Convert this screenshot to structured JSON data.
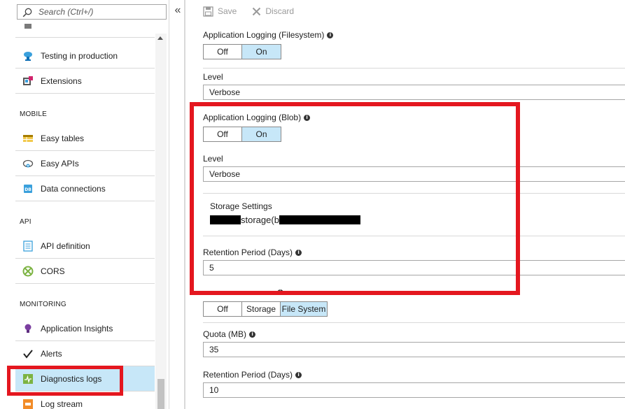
{
  "search": {
    "placeholder": "Search (Ctrl+/)"
  },
  "sidebar": {
    "collapse_glyph": "«",
    "items_top": [
      {
        "label": "Testing in production",
        "icon": "cloud-flask-icon"
      },
      {
        "label": "Extensions",
        "icon": "extensions-icon"
      }
    ],
    "sections": [
      {
        "header": "MOBILE",
        "items": [
          {
            "label": "Easy tables",
            "icon": "table-icon"
          },
          {
            "label": "Easy APIs",
            "icon": "cloud-api-icon"
          },
          {
            "label": "Data connections",
            "icon": "database-icon"
          }
        ]
      },
      {
        "header": "API",
        "items": [
          {
            "label": "API definition",
            "icon": "document-icon"
          },
          {
            "label": "CORS",
            "icon": "cors-icon"
          }
        ]
      },
      {
        "header": "MONITORING",
        "items": [
          {
            "label": "Application Insights",
            "icon": "lightbulb-icon"
          },
          {
            "label": "Alerts",
            "icon": "checkmark-icon"
          },
          {
            "label": "Diagnostics logs",
            "icon": "diagnostics-icon",
            "selected": true
          },
          {
            "label": "Log stream",
            "icon": "log-stream-icon"
          }
        ]
      }
    ]
  },
  "toolbar": {
    "save_label": "Save",
    "discard_label": "Discard"
  },
  "form": {
    "app_logging_fs": {
      "label": "Application Logging (Filesystem)",
      "off": "Off",
      "on": "On",
      "value": "On"
    },
    "level_fs": {
      "label": "Level",
      "value": "Verbose"
    },
    "app_logging_blob": {
      "label": "Application Logging (Blob)",
      "off": "Off",
      "on": "On",
      "value": "On"
    },
    "level_blob": {
      "label": "Level",
      "value": "Verbose"
    },
    "storage": {
      "label": "Storage Settings",
      "value": "storage(b"
    },
    "retention_blob": {
      "label": "Retention Period (Days)",
      "value": "5"
    },
    "web_logging": {
      "options": [
        "Off",
        "Storage",
        "File System"
      ],
      "value": "File System"
    },
    "quota": {
      "label": "Quota (MB)",
      "value": "35"
    },
    "retention_fs": {
      "label": "Retention Period (Days)",
      "value": "10"
    }
  },
  "colors": {
    "highlight": "#e4171f",
    "selected": "#c7e7f8"
  }
}
